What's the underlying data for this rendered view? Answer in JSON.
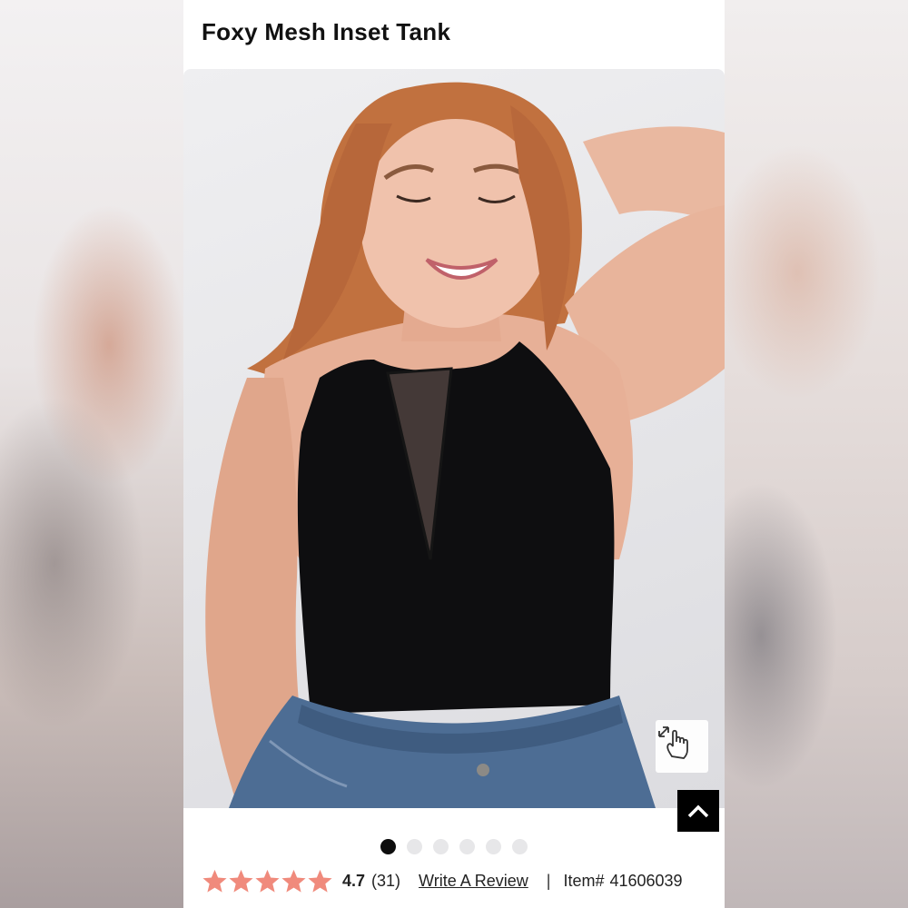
{
  "product": {
    "title": "Foxy Mesh Inset Tank"
  },
  "gallery": {
    "image_count": 6,
    "active_index": 0
  },
  "rating": {
    "value": "4.7",
    "count": "(31)",
    "stars": 5,
    "star_color": "#f08a7c"
  },
  "actions": {
    "write_review": "Write A Review"
  },
  "item": {
    "separator": "|",
    "label": "Item#",
    "number": "41606039"
  },
  "icons": {
    "zoom": "tap-zoom-icon",
    "back_to_top": "chevron-up-icon"
  }
}
